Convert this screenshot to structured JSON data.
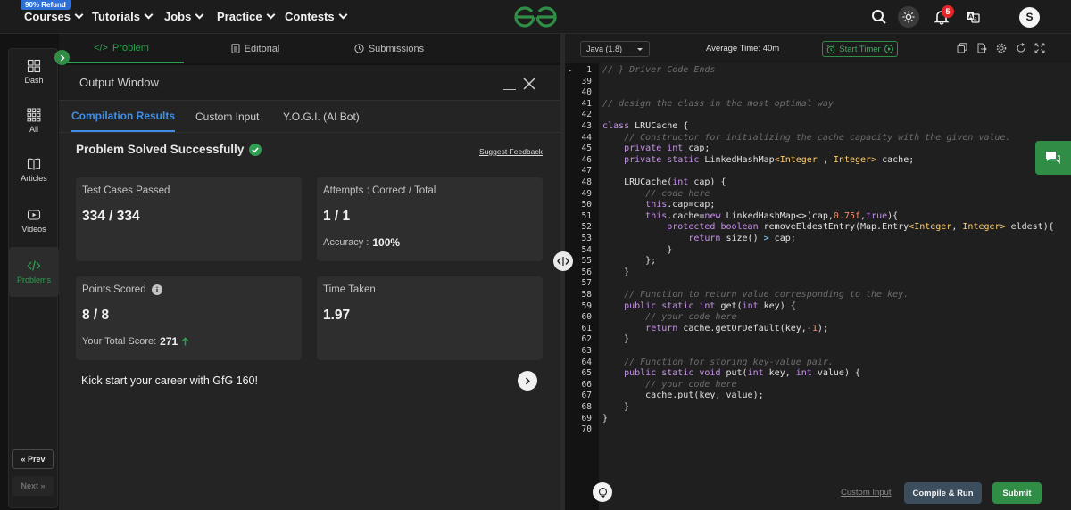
{
  "topnav": {
    "refund_badge": "90% Refund",
    "items": [
      {
        "label": "Courses"
      },
      {
        "label": "Tutorials"
      },
      {
        "label": "Jobs"
      },
      {
        "label": "Practice"
      },
      {
        "label": "Contests"
      }
    ],
    "notification_count": "5",
    "avatar_initial": "S",
    "brand_color": "#2f8d46"
  },
  "sidebar": {
    "items": [
      {
        "label": "Dash",
        "icon": "dashboard-icon"
      },
      {
        "label": "All",
        "icon": "grid-icon"
      },
      {
        "label": "Articles",
        "icon": "book-icon"
      },
      {
        "label": "Videos",
        "icon": "video-icon"
      },
      {
        "label": "Problems",
        "icon": "code-icon",
        "active": true
      }
    ],
    "prev_label": "Prev",
    "next_label": "Next"
  },
  "left_tabs": {
    "problem": "Problem",
    "editorial": "Editorial",
    "submissions": "Submissions"
  },
  "output_window": {
    "title": "Output Window",
    "tabs": [
      "Compilation Results",
      "Custom Input",
      "Y.O.G.I. (AI Bot)"
    ],
    "status_title": "Problem Solved Successfully",
    "suggest_feedback": "Suggest Feedback",
    "cards": {
      "test_cases": {
        "label": "Test Cases Passed",
        "value": "334 / 334"
      },
      "attempts": {
        "label": "Attempts : Correct / Total",
        "value": "1 / 1",
        "sub_label": "Accuracy :",
        "sub_value": "100%"
      },
      "points": {
        "label": "Points Scored",
        "value": "8 / 8",
        "sub_label": "Your Total Score:",
        "sub_value": "271"
      },
      "time": {
        "label": "Time Taken",
        "value": "1.97"
      }
    },
    "kick_start": "Kick start your career with GfG 160!"
  },
  "editor": {
    "language": "Java (1.8)",
    "average_time": "Average Time: 40m",
    "start_timer": "Start Timer",
    "lines": [
      {
        "no": "1",
        "html": "<span class=\"cm\">// } Driver Code Ends</span>"
      },
      {
        "no": "39",
        "html": ""
      },
      {
        "no": "40",
        "html": ""
      },
      {
        "no": "41",
        "html": "<span class=\"cm\">// design the class in the most optimal way</span>"
      },
      {
        "no": "42",
        "html": ""
      },
      {
        "no": "43",
        "html": "<span class=\"kw\">class</span> LRUCache {"
      },
      {
        "no": "44",
        "html": "    <span class=\"cm\">// Constructor for initializing the cache capacity with the given value.</span>"
      },
      {
        "no": "45",
        "html": "    <span class=\"kw\">private int</span> cap;"
      },
      {
        "no": "46",
        "html": "    <span class=\"kw\">private static</span> LinkedHashMap<span class=\"ty\">&lt;Integer</span> , <span class=\"ty\">Integer&gt;</span> cache;"
      },
      {
        "no": "47",
        "html": ""
      },
      {
        "no": "48",
        "html": "    LRUCache(<span class=\"kw\">int</span> cap) {"
      },
      {
        "no": "49",
        "html": "        <span class=\"cm\">// code here</span>"
      },
      {
        "no": "50",
        "html": "        <span class=\"kw\">this</span>.cap=cap;"
      },
      {
        "no": "51",
        "html": "        <span class=\"kw\">this</span>.cache=<span class=\"kw\">new</span> LinkedHashMap&lt;&gt;(cap,<span class=\"num\">0.75f</span>,<span class=\"kw\">true</span>){"
      },
      {
        "no": "52",
        "html": "            <span class=\"kw\">protected boolean</span> removeEldestEntry(Map.Entry<span class=\"ty\">&lt;Integer</span>, <span class=\"ty\">Integer&gt;</span> eldest){"
      },
      {
        "no": "53",
        "html": "                <span class=\"kw\">return</span> size() <span class=\"op\">&gt;</span> cap;"
      },
      {
        "no": "54",
        "html": "            }"
      },
      {
        "no": "55",
        "html": "        };"
      },
      {
        "no": "56",
        "html": "    }"
      },
      {
        "no": "57",
        "html": ""
      },
      {
        "no": "58",
        "html": "    <span class=\"cm\">// Function to return value corresponding to the key.</span>"
      },
      {
        "no": "59",
        "html": "    <span class=\"kw\">public static int</span> get(<span class=\"kw\">int</span> key) {"
      },
      {
        "no": "60",
        "html": "        <span class=\"cm\">// your code here</span>"
      },
      {
        "no": "61",
        "html": "        <span class=\"kw\">return</span> cache.getOrDefault(key,<span class=\"num\">-1</span>);"
      },
      {
        "no": "62",
        "html": "    }"
      },
      {
        "no": "63",
        "html": ""
      },
      {
        "no": "64",
        "html": "    <span class=\"cm\">// Function for storing key-value pair.</span>"
      },
      {
        "no": "65",
        "html": "    <span class=\"kw\">public static void</span> put(<span class=\"kw\">int</span> key, <span class=\"kw\">int</span> value) {"
      },
      {
        "no": "66",
        "html": "        <span class=\"cm\">// your code here</span>"
      },
      {
        "no": "67",
        "html": "        cache.put(key, value);"
      },
      {
        "no": "68",
        "html": "    }"
      },
      {
        "no": "69",
        "html": "}"
      },
      {
        "no": "70",
        "html": ""
      }
    ],
    "custom_input": "Custom Input",
    "compile_run": "Compile & Run",
    "submit": "Submit"
  }
}
